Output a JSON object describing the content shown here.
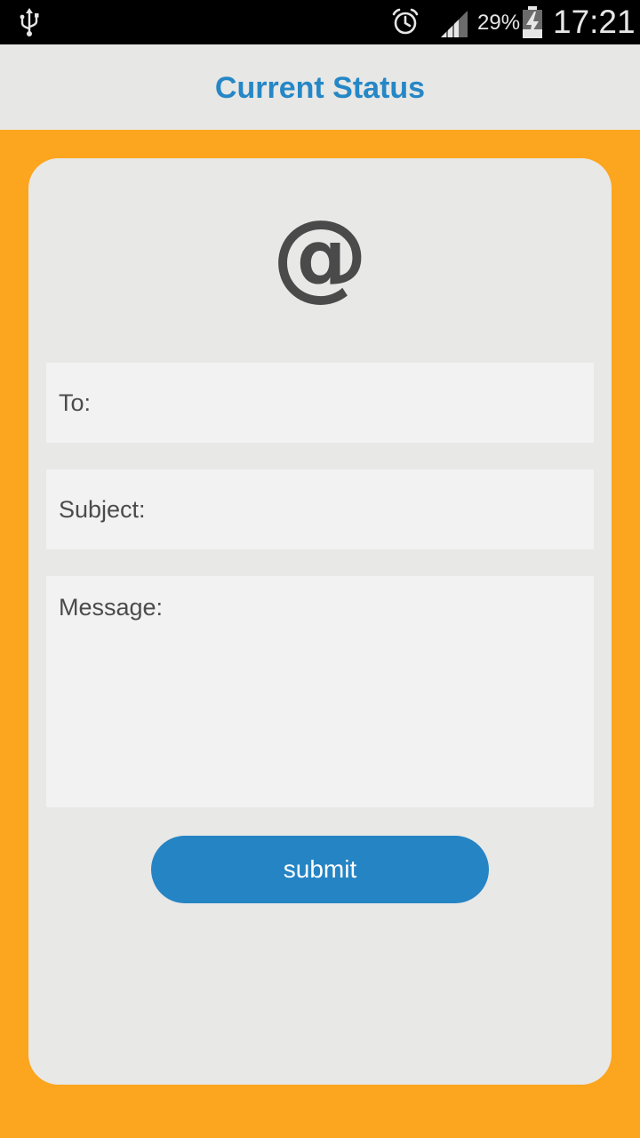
{
  "status_bar": {
    "battery_percent": "29%",
    "time": "17:21",
    "icons": [
      "usb-icon",
      "alarm-icon",
      "signal-icon",
      "battery-charging-icon"
    ]
  },
  "header": {
    "title": "Current Status"
  },
  "form": {
    "icon_glyph": "@",
    "to_placeholder": "To:",
    "subject_placeholder": "Subject:",
    "message_placeholder": "Message:",
    "submit_label": "submit"
  },
  "colors": {
    "accent_blue": "#2587c6",
    "background_orange": "#fca51e",
    "card_gray": "#e8e8e6"
  }
}
